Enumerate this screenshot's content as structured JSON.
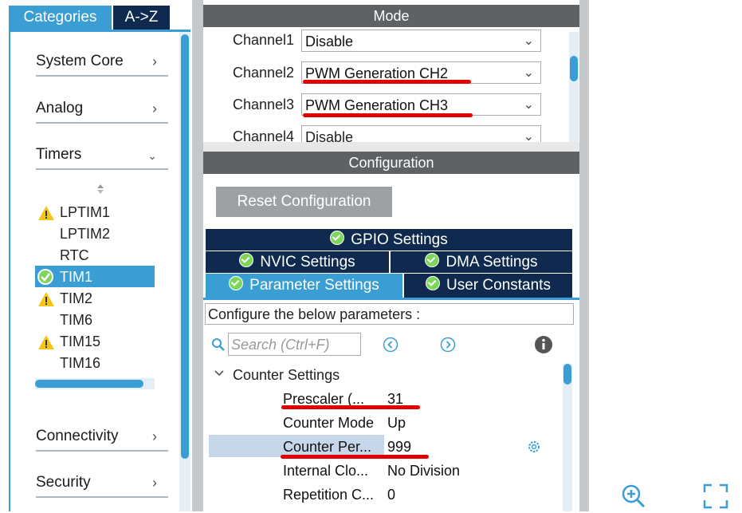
{
  "left_panel": {
    "tabs": {
      "categories": "Categories",
      "a_to_z": "A->Z"
    },
    "categories": [
      {
        "label": "System Core"
      },
      {
        "label": "Analog"
      },
      {
        "label": "Timers"
      },
      {
        "label": "Connectivity"
      },
      {
        "label": "Security"
      }
    ],
    "timers": [
      {
        "label": "LPTIM1",
        "status": "warning"
      },
      {
        "label": "LPTIM2",
        "status": "none"
      },
      {
        "label": "RTC",
        "status": "none"
      },
      {
        "label": "TIM1",
        "status": "ok",
        "selected": true
      },
      {
        "label": "TIM2",
        "status": "warning"
      },
      {
        "label": "TIM6",
        "status": "none"
      },
      {
        "label": "TIM15",
        "status": "warning"
      },
      {
        "label": "TIM16",
        "status": "none"
      }
    ]
  },
  "mode": {
    "header": "Mode",
    "channels": [
      {
        "label": "Channel1",
        "value": "Disable"
      },
      {
        "label": "Channel2",
        "value": "PWM Generation CH2"
      },
      {
        "label": "Channel3",
        "value": "PWM Generation CH3"
      },
      {
        "label": "Channel4",
        "value": "Disable"
      }
    ]
  },
  "configuration": {
    "header": "Configuration",
    "reset_button": "Reset Configuration",
    "tabs": {
      "gpio": "GPIO Settings",
      "nvic": "NVIC Settings",
      "dma": "DMA Settings",
      "parameter": "Parameter Settings",
      "user_constants": "User Constants"
    },
    "description": "Configure the below parameters :",
    "search_placeholder": "Search (Ctrl+F)",
    "group": "Counter Settings",
    "params": [
      {
        "label": "Prescaler (...",
        "value": "31"
      },
      {
        "label": "Counter Mode",
        "value": "Up"
      },
      {
        "label": "Counter Per...",
        "value": "999"
      },
      {
        "label": "Internal Clo...",
        "value": "No Division"
      },
      {
        "label": "Repetition C...",
        "value": "0"
      }
    ]
  },
  "colors": {
    "accent": "#3a9ed5",
    "dark_navy": "#0f2a4e",
    "header_gray": "#5e6265",
    "annotation_red": "#e00000",
    "warning_yellow": "#f5c518",
    "ok_green": "#7dd65a"
  }
}
